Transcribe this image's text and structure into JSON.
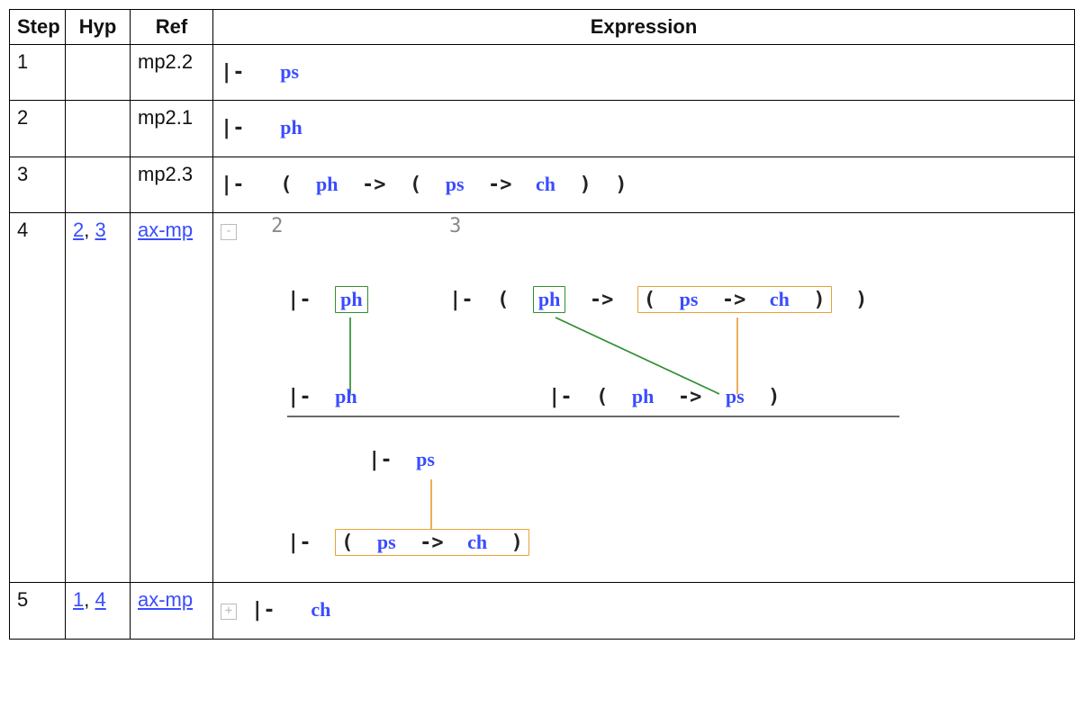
{
  "headers": {
    "step": "Step",
    "hyp": "Hyp",
    "ref": "Ref",
    "expr": "Expression"
  },
  "rows": {
    "r1": {
      "step": "1",
      "ref": "mp2.2"
    },
    "r2": {
      "step": "2",
      "ref": "mp2.1"
    },
    "r3": {
      "step": "3",
      "ref": "mp2.3"
    },
    "r4": {
      "step": "4",
      "hyp1": "2",
      "hyp2": "3",
      "ref": "ax-mp"
    },
    "r5": {
      "step": "5",
      "hyp1": "1",
      "hyp2": "4",
      "ref": "ax-mp"
    }
  },
  "tokens": {
    "turnstile": "|-",
    "arrow": "->",
    "lparen": "(",
    "rparen": ")",
    "comma": ", ",
    "ph": "ph",
    "ps": "ps",
    "ch": "ch"
  },
  "toggle": {
    "minus": "-",
    "plus": "+"
  },
  "diagram": {
    "label2": "2",
    "label3": "3"
  }
}
